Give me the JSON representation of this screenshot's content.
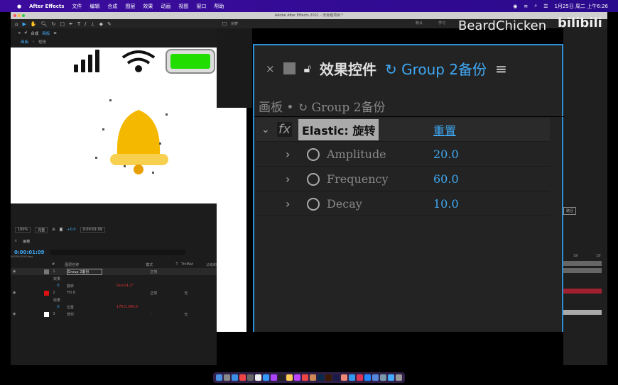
{
  "menubar": {
    "apple": "",
    "app": "After Effects",
    "items": [
      "文件",
      "编辑",
      "合成",
      "图层",
      "效果",
      "动画",
      "视图",
      "窗口",
      "帮助"
    ],
    "clock": "1月25日 周二 上午6:26"
  },
  "window": {
    "title": "Adobe After Effects 2021 - 无标题项目 *"
  },
  "toolbar": {
    "align_label": "对齐"
  },
  "workspaces": [
    "默认",
    "学习"
  ],
  "watermark": {
    "brand": "BeardChicken",
    "logo": "bilibili"
  },
  "comp_panel": {
    "title": "合成",
    "comp_name": "画板",
    "crumb_root": "画板",
    "crumb_child": "矩形"
  },
  "viewer_bar": {
    "zoom": "100%",
    "quality": "完整",
    "exposure": "+0.0",
    "time": "0:00:01:09"
  },
  "timeline": {
    "tab": "画板",
    "timecode": "0:00:01:09",
    "frames": "00039 (30.00 fps)",
    "search_placeholder": "",
    "columns": [
      "#",
      "图层名称",
      "模式",
      "T",
      "TrkMat",
      "父级和"
    ],
    "layers": [
      {
        "num": "1",
        "name": "Group 2备份",
        "mode": "正常",
        "color": "#777777",
        "sub": "效果",
        "prop": "旋转",
        "prop_value": "0x+14.2°"
      },
      {
        "num": "2",
        "name": "Fill 8",
        "mode": "正常",
        "trkmat": "无",
        "color": "#dd1111",
        "sub": "效果",
        "prop": "位置",
        "prop_value": "176.0,366.0"
      },
      {
        "num": "3",
        "name": "矩形",
        "mode": "-",
        "trkmat": "无",
        "color": "#ffffff"
      }
    ]
  },
  "effect_controls": {
    "title": "效果控件",
    "layer": "Group 2备份",
    "crumb": "画板 • ↻ Group 2备份",
    "effect": "Elastic: 旋转",
    "reset": "重置",
    "params": [
      {
        "name": "Amplitude",
        "value": "20.0"
      },
      {
        "name": "Frequency",
        "value": "60.0"
      },
      {
        "name": "Decay",
        "value": "10.0"
      }
    ]
  },
  "right_panel": {
    "button": "路径",
    "ruler": [
      "10f",
      "15f"
    ]
  },
  "colors": {
    "menubar": "#3d0c9e",
    "accent": "#3fa9f5",
    "battery": "#22dd00",
    "bell": "#f5b800"
  }
}
